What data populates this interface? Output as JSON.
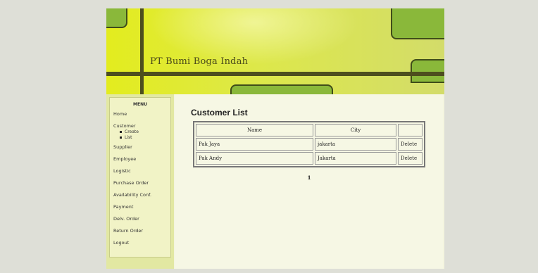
{
  "header": {
    "company_name": "PT Bumi Boga Indah"
  },
  "menu": {
    "title": "MENU",
    "items": [
      {
        "label": "Home"
      },
      {
        "label": "Customer",
        "subitems": [
          {
            "label": "Create"
          },
          {
            "label": "List"
          }
        ]
      },
      {
        "label": "Supplier"
      },
      {
        "label": "Employee"
      },
      {
        "label": "Logistic"
      },
      {
        "label": "Purchase Order"
      },
      {
        "label": "Availability Conf."
      },
      {
        "label": "Payment"
      },
      {
        "label": "Delv. Order"
      },
      {
        "label": "Return Order"
      },
      {
        "label": "Logout"
      }
    ]
  },
  "main": {
    "title": "Customer List",
    "table": {
      "headers": [
        "Name",
        "City",
        ""
      ],
      "rows": [
        {
          "name": "Pak Jaya",
          "city": "jakarta",
          "action": "Delete"
        },
        {
          "name": "Pak Andy",
          "city": "Jakarta",
          "action": "Delete"
        }
      ]
    },
    "pagination": {
      "current_page": "1"
    }
  },
  "colors": {
    "banner": "#e3ec1e",
    "accent_block": "#8ab83a",
    "dark_bar": "#4d4e1e",
    "background": "#dedfd7"
  }
}
